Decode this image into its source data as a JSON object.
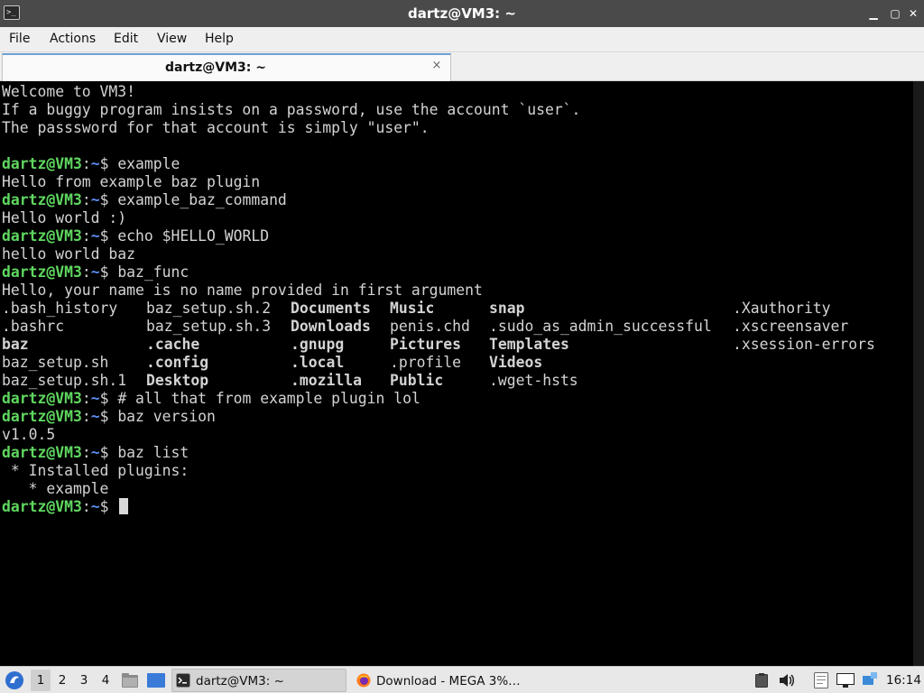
{
  "window": {
    "title": "dartz@VM3: ~",
    "min": "▁",
    "max": "▢",
    "close": "✕"
  },
  "menu": {
    "file": "File",
    "actions": "Actions",
    "edit": "Edit",
    "view": "View",
    "help": "Help"
  },
  "tab": {
    "label": "dartz@VM3: ~",
    "close": "×"
  },
  "prompt": {
    "user": "dartz@VM3",
    "sep": ":",
    "path": "~",
    "dollar": "$ "
  },
  "terminal": {
    "welcome1": "Welcome to VM3!",
    "welcome2": "If a buggy program insists on a password, use the account `user`.",
    "welcome3": "The passsword for that account is simply \"user\".",
    "cmd1": "example",
    "out1": "Hello from example baz plugin",
    "cmd2": "example_baz_command",
    "out2": "Hello world :)",
    "cmd3": "echo $HELLO_WORLD",
    "out3": "hello world baz",
    "cmd4": "baz_func",
    "out4": "Hello, your name is no name provided in first argument",
    "ls": [
      [
        ".bash_history",
        "baz_setup.sh.2",
        "Documents",
        "Music",
        "snap",
        ".Xauthority"
      ],
      [
        ".bashrc",
        "baz_setup.sh.3",
        "Downloads",
        "penis.chd",
        ".sudo_as_admin_successful",
        ".xscreensaver"
      ],
      [
        "baz",
        ".cache",
        ".gnupg",
        "Pictures",
        "Templates",
        ".xsession-errors"
      ],
      [
        "baz_setup.sh",
        ".config",
        ".local",
        ".profile",
        "Videos",
        ""
      ],
      [
        "baz_setup.sh.1",
        "Desktop",
        ".mozilla",
        "Public",
        ".wget-hsts",
        ""
      ]
    ],
    "cmd5": "# all that from example plugin lol",
    "cmd6": "baz version",
    "out6": "v1.0.5",
    "cmd7": "baz list",
    "out7a": " * Installed plugins:",
    "out7b": "   * example"
  },
  "taskbar": {
    "workspaces": [
      "1",
      "2",
      "3",
      "4"
    ],
    "task_terminal": "dartz@VM3: ~",
    "task_firefox": "Download - MEGA 3%…",
    "clock": "16:14"
  },
  "colors": {
    "prompt_user": "#5fd75f",
    "prompt_path": "#5b8cf0",
    "directory": "#7a7aff"
  }
}
